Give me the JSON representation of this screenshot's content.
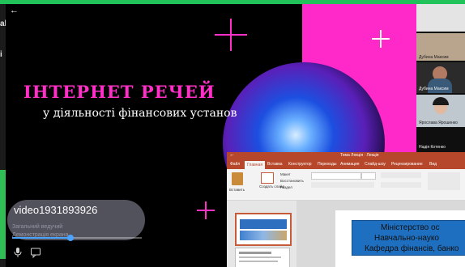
{
  "presentation": {
    "title": "ІНТЕРНЕТ РЕЧЕЙ",
    "subtitle": "у діяльності фінансових установ"
  },
  "video": {
    "back_glyph": "←",
    "participant_name": "video1931893926",
    "ghost_line_1": "Загальний ведучий",
    "ghost_line_2": "Демонстрація екрана"
  },
  "left_edge": [
    "ab",
    "i"
  ],
  "participants": [
    {
      "name": "",
      "color": "#e4e4e4"
    },
    {
      "name": "Дубина Максим",
      "color": "#b9a48e"
    },
    {
      "name": "Дубина Максим",
      "color": "#2b2b2b"
    },
    {
      "name": "Ярослава Ярошенко",
      "color": "#bfc7cf"
    },
    {
      "name": "Надія Котенко",
      "color": "#0f0f0f"
    }
  ],
  "ppt": {
    "window_title": "Тема Лекція · Лекція",
    "back_glyph": "←",
    "tabs": [
      "Файл",
      "Главная",
      "Вставка",
      "Конструктор",
      "Переходы",
      "Анимация",
      "Слайд-шоу",
      "Рецензирование",
      "Вид"
    ],
    "ribbon": {
      "paste": "Вставить",
      "create": "Создать слайд",
      "layout": "Макет",
      "restore": "Восстановить",
      "section": "Раздел"
    },
    "slide_lines": [
      "Міністерство ос",
      "Навчально-науко",
      "Кафедра фінансів, банко"
    ]
  },
  "icons": {
    "mic": "microphone-icon",
    "chat": "chat-icon"
  },
  "progress": 0.45
}
